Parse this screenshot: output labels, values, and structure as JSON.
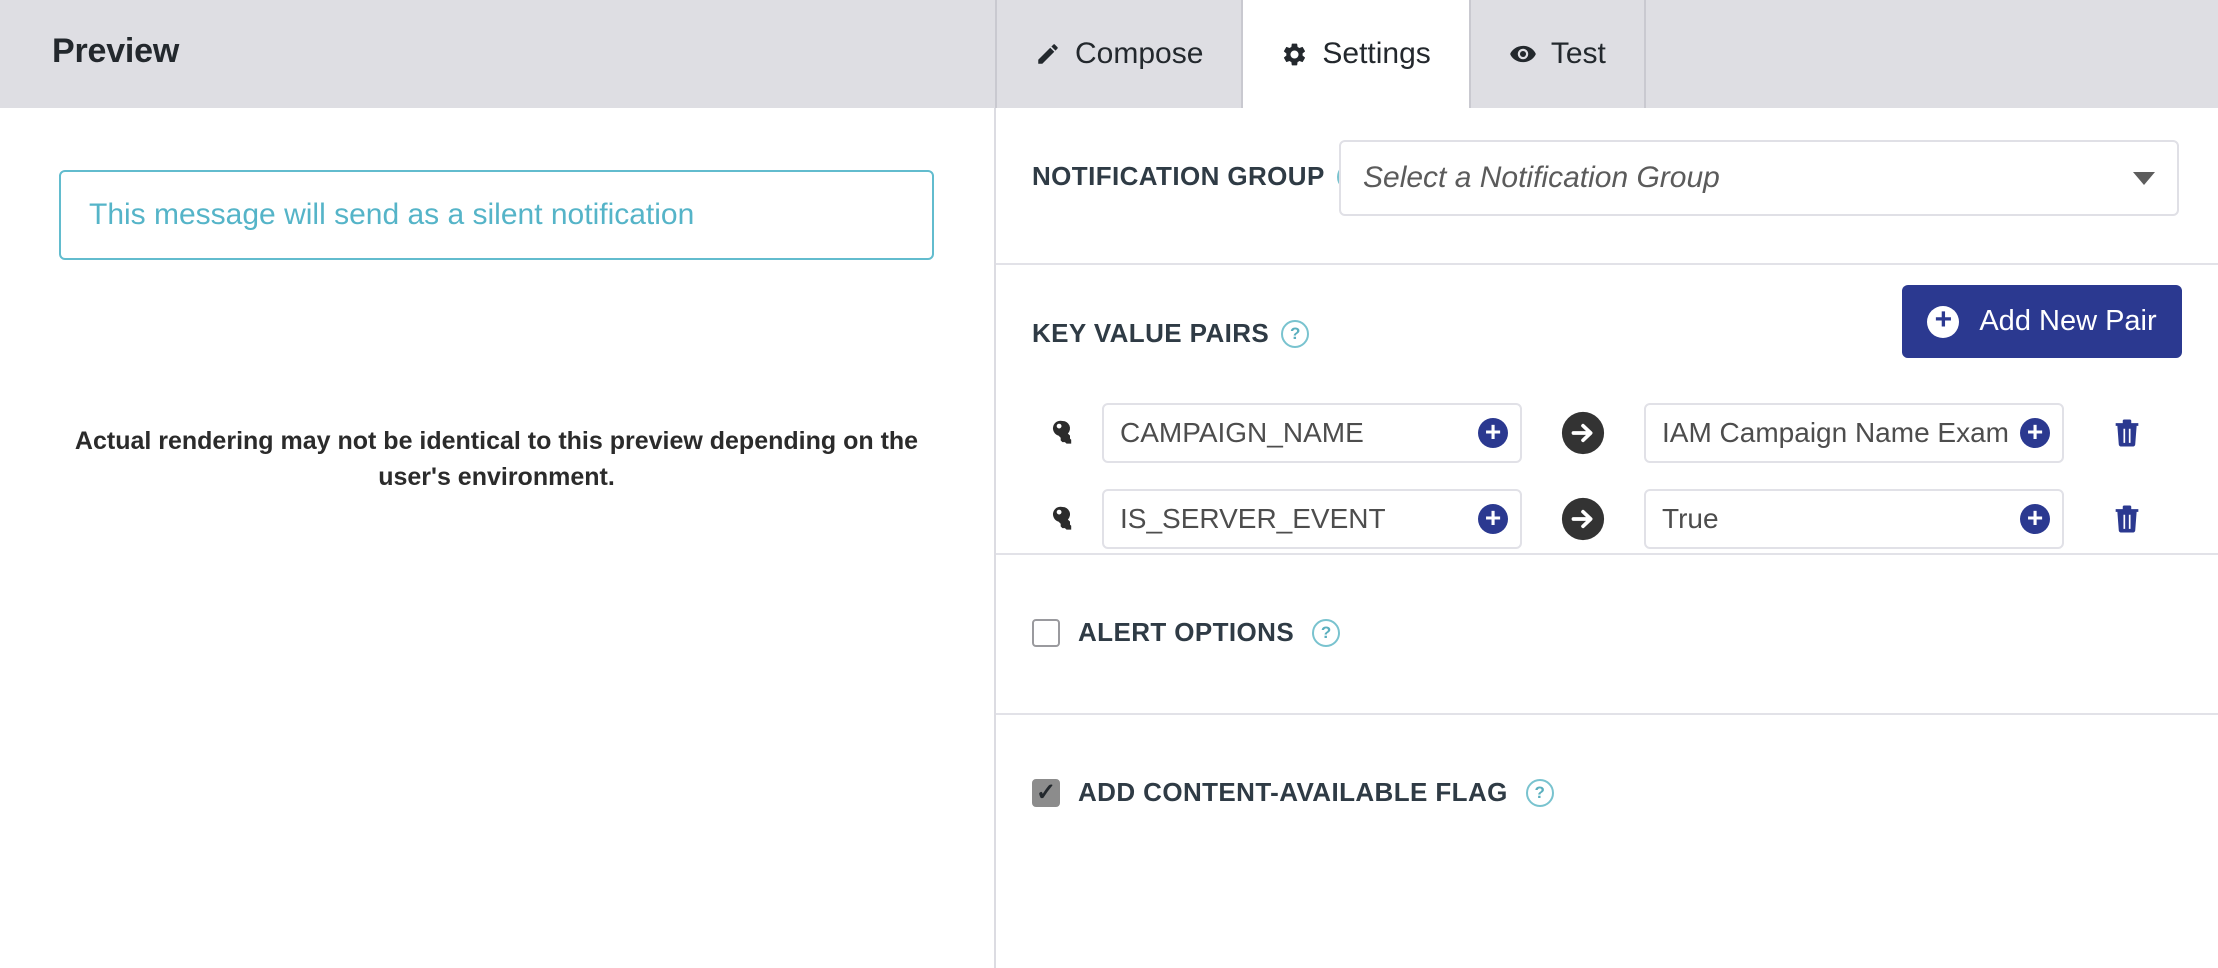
{
  "header": {
    "title": "Preview",
    "tabs": [
      {
        "label": "Compose",
        "icon": "pencil-icon",
        "active": false
      },
      {
        "label": "Settings",
        "icon": "gear-icon",
        "active": true
      },
      {
        "label": "Test",
        "icon": "eye-icon",
        "active": false
      }
    ]
  },
  "preview": {
    "silent_message": "This message will send as a silent notification",
    "note": "Actual rendering may not be identical to this preview depending on the user's environment."
  },
  "settings": {
    "notification_group": {
      "label": "NOTIFICATION GROUP",
      "help": "?",
      "selected": "Select a Notification Group"
    },
    "key_value_pairs": {
      "label": "KEY VALUE PAIRS",
      "help": "?",
      "add_button": "Add New Pair",
      "add_icon": "plus-circle-icon",
      "rows": [
        {
          "key_icon": "key-icon",
          "key": "CAMPAIGN_NAME",
          "key_add_icon": "plus-circle-icon",
          "arrow_icon": "arrow-right-circle-icon",
          "value": "IAM Campaign Name Example",
          "value_add_icon": "plus-circle-icon",
          "delete_icon": "trash-icon"
        },
        {
          "key_icon": "key-icon",
          "key": "IS_SERVER_EVENT",
          "key_add_icon": "plus-circle-icon",
          "arrow_icon": "arrow-right-circle-icon",
          "value": "True",
          "value_add_icon": "plus-circle-icon",
          "delete_icon": "trash-icon"
        }
      ]
    },
    "alert_options": {
      "label": "ALERT OPTIONS",
      "help": "?",
      "checked": false
    },
    "content_available": {
      "label": "ADD CONTENT-AVAILABLE FLAG",
      "help": "?",
      "checked": true
    }
  },
  "colors": {
    "header_bg": "#dedee3",
    "accent_blue": "#2b3990",
    "teal": "#55b4c8",
    "text_dark": "#2f3b45",
    "divider": "#e2e2e8"
  }
}
